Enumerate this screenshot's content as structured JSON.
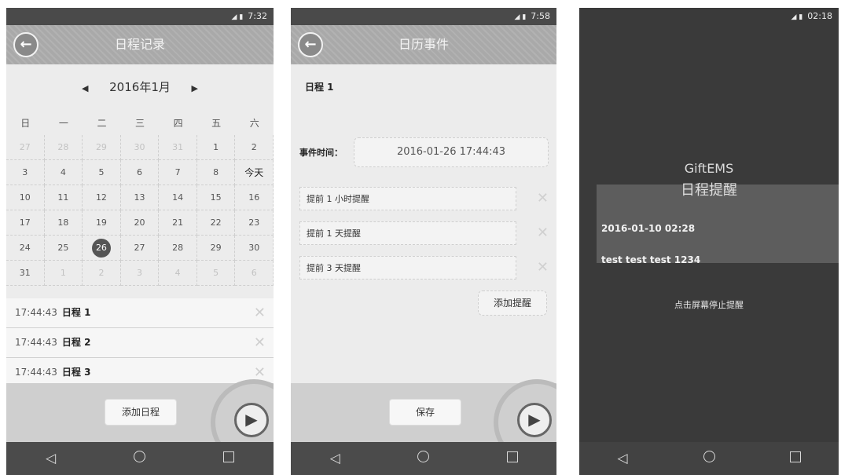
{
  "screens": [
    {
      "status": {
        "time": "7:32"
      },
      "title": "日程记录",
      "calendar": {
        "month": "2016年1月",
        "weekdays": [
          "日",
          "一",
          "二",
          "三",
          "四",
          "五",
          "六"
        ],
        "weeks": [
          [
            "27",
            "28",
            "29",
            "30",
            "31",
            "1",
            "2"
          ],
          [
            "3",
            "4",
            "5",
            "6",
            "7",
            "8",
            "今天"
          ],
          [
            "10",
            "11",
            "12",
            "13",
            "14",
            "15",
            "16"
          ],
          [
            "17",
            "18",
            "19",
            "20",
            "21",
            "22",
            "23"
          ],
          [
            "24",
            "25",
            "26",
            "27",
            "28",
            "29",
            "30"
          ],
          [
            "31",
            "1",
            "2",
            "3",
            "4",
            "5",
            "6"
          ]
        ],
        "selected": "26"
      },
      "events": [
        {
          "time": "17:44:43",
          "name": "日程 1"
        },
        {
          "time": "17:44:43",
          "name": "日程 2"
        },
        {
          "time": "17:44:43",
          "name": "日程 3"
        }
      ],
      "add_button": "添加日程"
    },
    {
      "status": {
        "time": "7:58"
      },
      "title": "日历事件",
      "event_name": "日程 1",
      "time_label": "事件时间：",
      "time_value": "2016-01-26 17:44:43",
      "reminders": [
        "提前 1 小时提醒",
        "提前 1 天提醒",
        "提前 3 天提醒"
      ],
      "add_reminder": "添加提醒",
      "save_button": "保存"
    },
    {
      "status": {
        "time": "02:18"
      },
      "app_name": "GiftEMS",
      "alarm_title": "日程提醒",
      "date": "2016-01-10 02:28",
      "message": "test test test 1234",
      "stop_hint": "点击屏幕停止提醒"
    }
  ],
  "icons": {
    "back": "arrow-left-icon",
    "play": "play-icon",
    "nav": [
      "back-triangle-icon",
      "home-circle-icon",
      "recents-square-icon"
    ]
  }
}
